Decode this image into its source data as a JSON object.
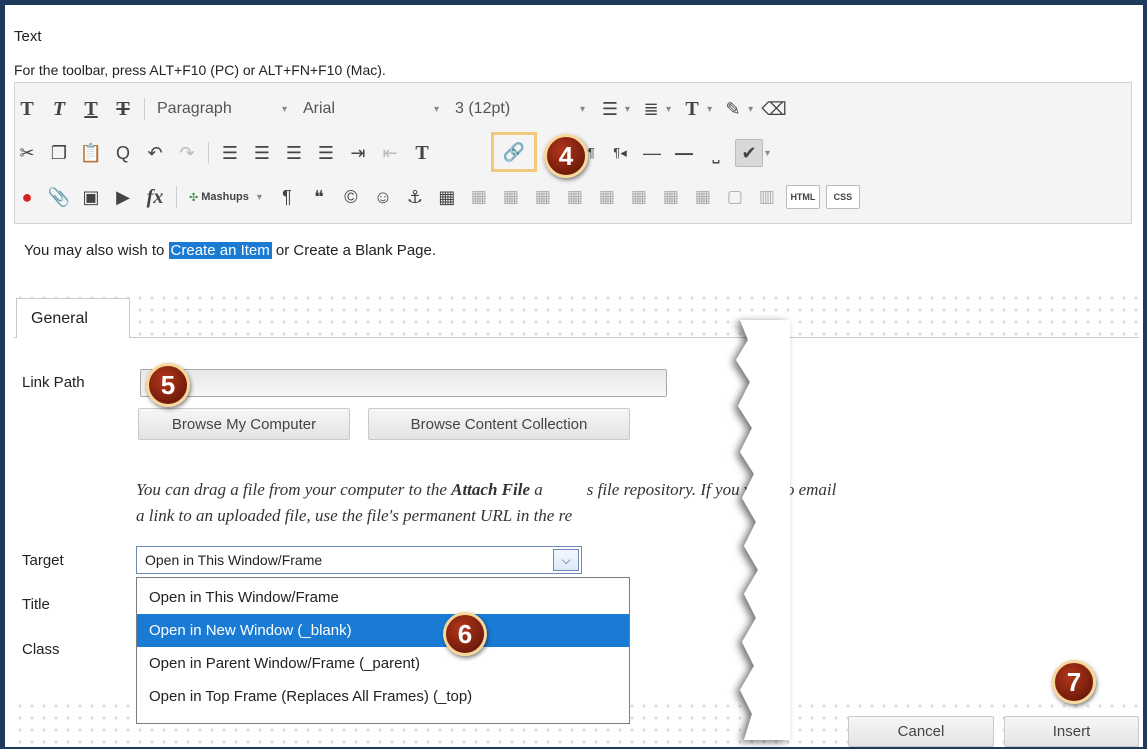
{
  "header": {
    "field_label": "Text",
    "toolbar_hint": "For the toolbar, press ALT+F10 (PC) or ALT+FN+F10 (Mac)."
  },
  "toolbar": {
    "paragraph_label": "Paragraph",
    "font_label": "Arial",
    "size_label": "3 (12pt)",
    "mashups_label": "Mashups",
    "html_label": "HTML",
    "css_label": "CSS"
  },
  "editor_content": {
    "prefix": "You may also wish to ",
    "highlighted": "Create an Item",
    "suffix": " or Create a Blank Page."
  },
  "tabs": {
    "general": "General"
  },
  "form": {
    "link_path_label": "Link Path",
    "link_path_value": "",
    "browse_computer": "Browse My Computer",
    "browse_collection": "Browse Content Collection",
    "info_part1": "You can drag a file from your computer to the ",
    "info_bold": "Attach File",
    "info_part2": " a",
    "info_part3": "s file repository. If you want to email",
    "info_line2": "a link to an uploaded file, use the file's permanent URL in the re",
    "target_label": "Target",
    "title_label": "Title",
    "class_label": "Class",
    "target_value": "Open in This Window/Frame",
    "target_options": [
      "Open in This Window/Frame",
      "Open in New Window (_blank)",
      "Open in Parent Window/Frame (_parent)",
      "Open in Top Frame (Replaces All Frames) (_top)"
    ],
    "selected_option_index": 1
  },
  "footer": {
    "cancel": "Cancel",
    "insert": "Insert"
  },
  "steps": [
    "4",
    "5",
    "6",
    "7"
  ],
  "colors": {
    "selection": "#1a7bd5",
    "step_badge": "#8e2410",
    "frame": "#1d3a5c"
  }
}
